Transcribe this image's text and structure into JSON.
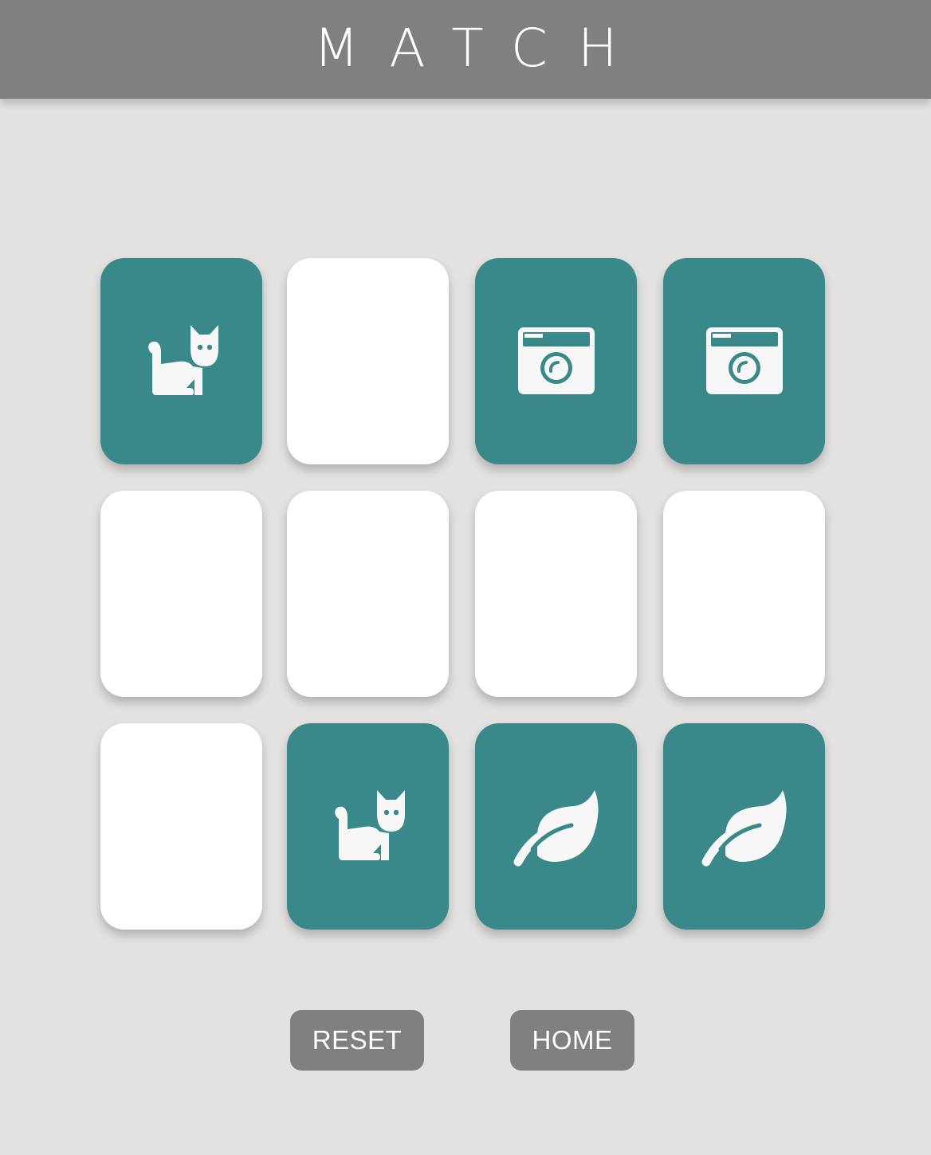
{
  "header": {
    "title": "MATCH"
  },
  "board": {
    "rows": 3,
    "cols": 4,
    "cards": [
      {
        "state": "face-up",
        "icon": "cat-icon"
      },
      {
        "state": "face-down",
        "icon": ""
      },
      {
        "state": "face-up",
        "icon": "camera-icon"
      },
      {
        "state": "face-up",
        "icon": "camera-icon"
      },
      {
        "state": "face-down",
        "icon": ""
      },
      {
        "state": "face-down",
        "icon": ""
      },
      {
        "state": "face-down",
        "icon": ""
      },
      {
        "state": "face-down",
        "icon": ""
      },
      {
        "state": "face-down",
        "icon": ""
      },
      {
        "state": "face-up",
        "icon": "cat-icon"
      },
      {
        "state": "face-up",
        "icon": "leaf-icon"
      },
      {
        "state": "face-up",
        "icon": "leaf-icon"
      }
    ]
  },
  "controls": {
    "reset_label": "RESET",
    "home_label": "HOME"
  },
  "colors": {
    "background": "#e3e2e1",
    "header": "#808080",
    "card_face_up": "#3a898a",
    "card_face_down": "#ffffff",
    "icon": "#f7f7f7",
    "button": "#808080"
  }
}
